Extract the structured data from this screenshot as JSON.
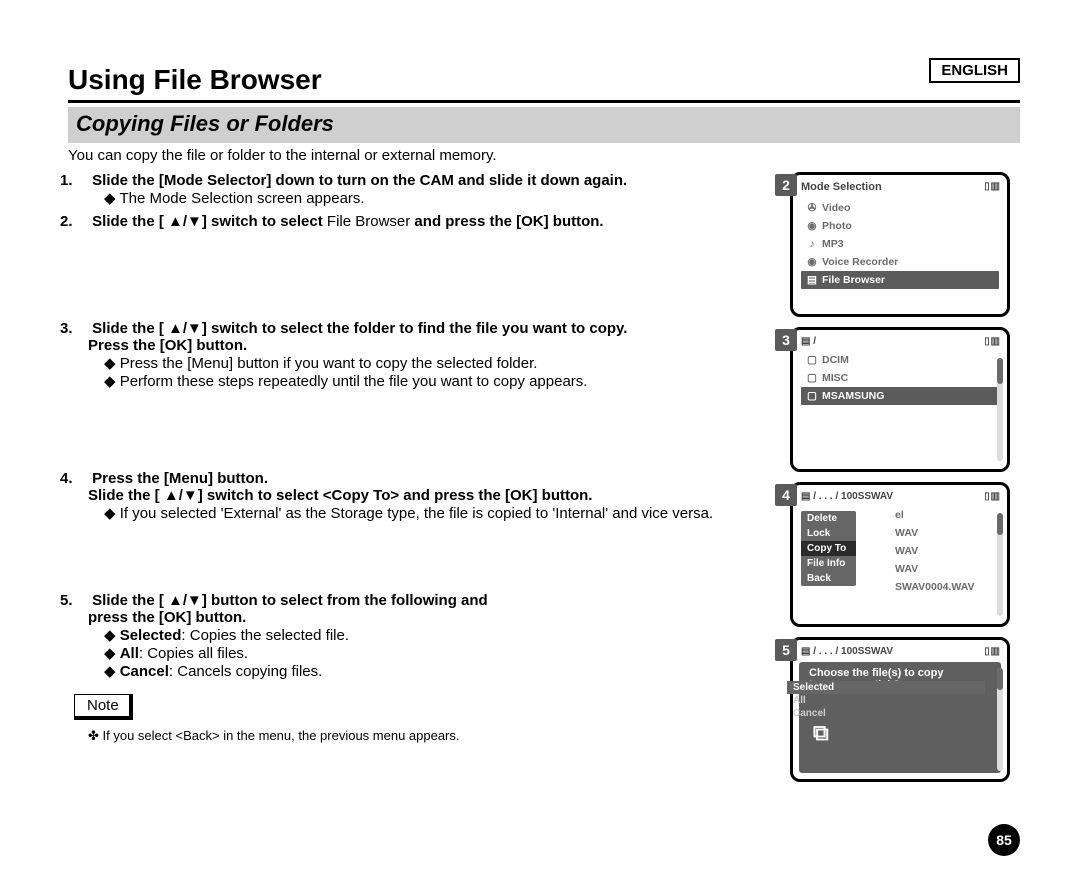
{
  "lang": "ENGLISH",
  "title": "Using File Browser",
  "subtitle": "Copying Files or Folders",
  "intro": "You can copy the file or folder to the internal or external memory.",
  "steps": {
    "s1": {
      "n": "1.",
      "head_a": "Slide the [Mode Selector] down to turn on the CAM and slide it down again.",
      "b1": "The Mode Selection screen appears."
    },
    "s2": {
      "n": "2.",
      "head_a": "Slide the [ ▲/▼] switch to select ",
      "head_light": "File Browser",
      "head_b": "  and press the [OK] button."
    },
    "s3": {
      "n": "3.",
      "head_a": "Slide the [ ▲/▼] switch to select the folder to find the file you want to copy.",
      "head_b": "Press the [OK] button.",
      "b1": "Press the [Menu] button if you want to copy the selected folder.",
      "b2": "Perform these steps repeatedly until the file you want to copy appears."
    },
    "s4": {
      "n": "4.",
      "head_a": "Press the [Menu] button.",
      "head_b": "Slide the [ ▲/▼] switch to select <Copy To> and press the [OK] button.",
      "b1": "If you selected 'External' as the Storage type, the file is copied to 'Internal' and vice versa."
    },
    "s5": {
      "n": "5.",
      "head_a": "Slide the [ ▲/▼] button to select from the following and",
      "head_b": "press the [OK] button.",
      "opt1_b": "Selected",
      "opt1_t": ": Copies the selected file.",
      "opt2_b": "All",
      "opt2_t": ": Copies all files.",
      "opt3_b": "Cancel",
      "opt3_t": ": Cancels copying files."
    }
  },
  "note_label": "Note",
  "note_text": "If you select <Back> in the menu, the previous menu appears.",
  "screens": {
    "s2": {
      "badge": "2",
      "title": "Mode Selection",
      "status": "▯ ▥",
      "items": [
        "Video",
        "Photo",
        "MP3",
        "Voice Recorder",
        "File Browser"
      ],
      "icons": [
        "✇",
        "◉",
        "♪",
        "◉",
        "▤"
      ],
      "sel": 4
    },
    "s3": {
      "badge": "3",
      "path": "▤ /",
      "status": "▯ ▥",
      "items": [
        "DCIM",
        "MISC",
        "MSAMSUNG"
      ],
      "sel": 2
    },
    "s4": {
      "badge": "4",
      "path": "▤ / . . . / 100SSWAV",
      "status": "▯ ▥",
      "menu": [
        "Delete",
        "Lock",
        "Copy To",
        "File Info",
        "Back"
      ],
      "menu_sel": 2,
      "bg_items": [
        "el",
        "WAV",
        "WAV",
        "WAV",
        "SWAV0004.WAV"
      ]
    },
    "s5": {
      "badge": "5",
      "path": "▤ / . . . / 100SSWAV",
      "status": "▯ ▥",
      "prompt1": "Choose the file(s) to copy",
      "prompt2": "to memory stick?",
      "opts": [
        "Selected",
        "All",
        "Cancel"
      ],
      "opt_sel": 0
    }
  },
  "page_number": "85"
}
